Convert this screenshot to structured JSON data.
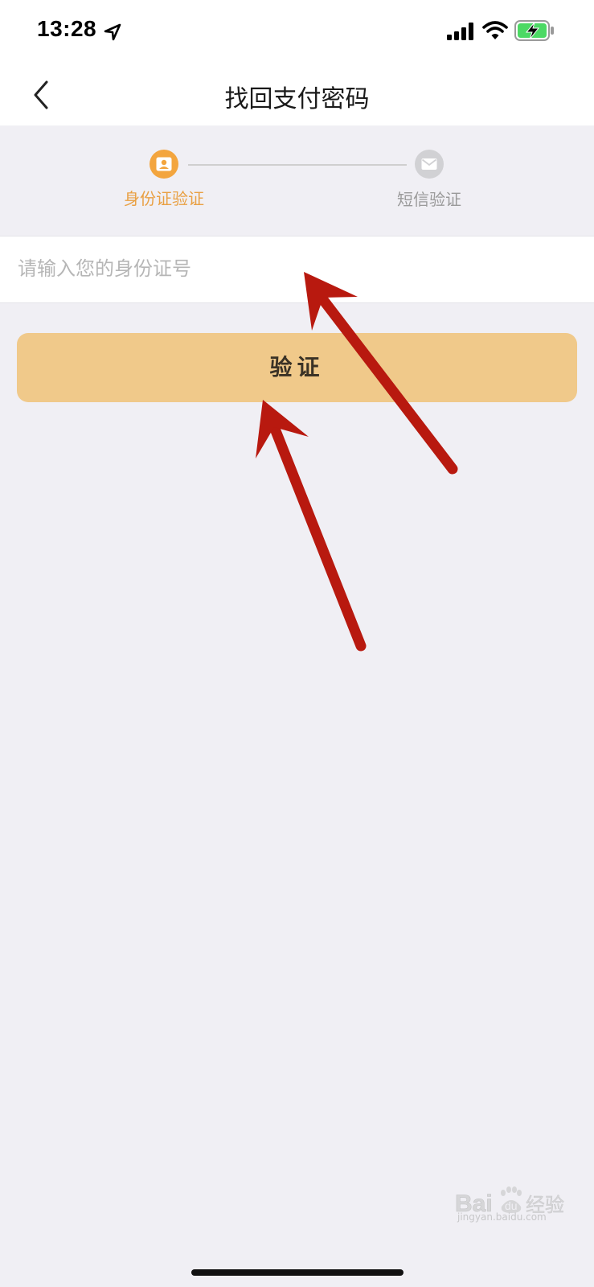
{
  "status_bar": {
    "time": "13:28"
  },
  "nav": {
    "title": "找回支付密码",
    "back_icon": "chevron-left-icon"
  },
  "steps": {
    "items": [
      {
        "label": "身份证验证",
        "icon": "id-card-icon",
        "state": "active"
      },
      {
        "label": "短信验证",
        "icon": "envelope-icon",
        "state": "inactive"
      }
    ]
  },
  "form": {
    "id_placeholder": "请输入您的身份证号",
    "id_value": ""
  },
  "actions": {
    "verify_label": "验证"
  },
  "watermark": {
    "brand": "Bai du 经验",
    "url": "jingyan.baidu.com"
  },
  "colors": {
    "accent": "#f3a53e",
    "button_bg": "#f0c98a",
    "page_bg": "#f0eff4",
    "annotation_arrow": "#b8190f"
  }
}
